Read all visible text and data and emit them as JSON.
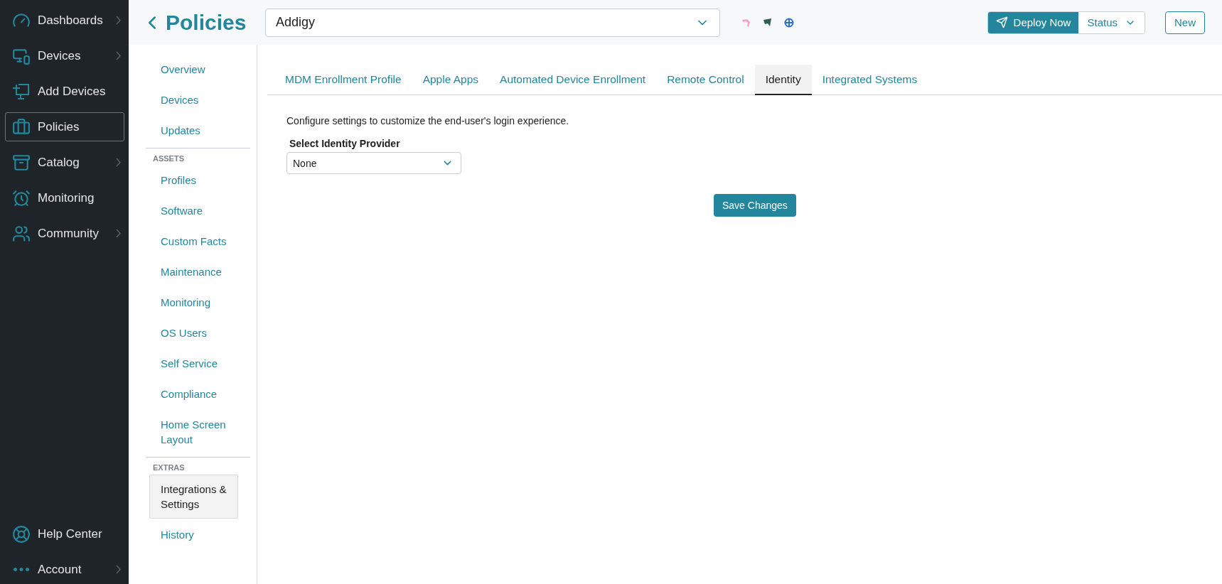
{
  "sidebar": {
    "items": [
      {
        "label": "Dashboards",
        "selected": false,
        "expandable": true
      },
      {
        "label": "Devices",
        "selected": false,
        "expandable": true
      },
      {
        "label": "Add Devices",
        "selected": false,
        "expandable": false
      },
      {
        "label": "Policies",
        "selected": true,
        "expandable": false
      },
      {
        "label": "Catalog",
        "selected": false,
        "expandable": true
      },
      {
        "label": "Monitoring",
        "selected": false,
        "expandable": false
      },
      {
        "label": "Community",
        "selected": false,
        "expandable": true
      }
    ],
    "footer_items": [
      {
        "label": "Help Center",
        "selected": false,
        "expandable": false
      },
      {
        "label": "Account",
        "selected": false,
        "expandable": true
      }
    ]
  },
  "header": {
    "title": "Policies",
    "policy_select": {
      "value": "Addigy"
    },
    "buttons": {
      "deploy": "Deploy Now",
      "status": "Status",
      "new": "New"
    }
  },
  "subnav": {
    "groups": [
      {
        "items": [
          {
            "label": "Overview",
            "selected": false
          },
          {
            "label": "Devices",
            "selected": false
          },
          {
            "label": "Updates",
            "selected": false
          }
        ]
      },
      {
        "heading": "ASSETS",
        "items": [
          {
            "label": "Profiles",
            "selected": false
          },
          {
            "label": "Software",
            "selected": false
          },
          {
            "label": "Custom Facts",
            "selected": false
          },
          {
            "label": "Maintenance",
            "selected": false
          },
          {
            "label": "Monitoring",
            "selected": false
          },
          {
            "label": "OS Users",
            "selected": false
          },
          {
            "label": "Self Service",
            "selected": false
          },
          {
            "label": "Compliance",
            "selected": false
          },
          {
            "label": "Home Screen Layout",
            "selected": false
          }
        ]
      },
      {
        "heading": "EXTRAS",
        "items": [
          {
            "label": "Integrations & Settings",
            "selected": true
          },
          {
            "label": "History",
            "selected": false
          }
        ]
      }
    ]
  },
  "tabs": [
    {
      "label": "MDM Enrollment Profile",
      "selected": false
    },
    {
      "label": "Apple Apps",
      "selected": false
    },
    {
      "label": "Automated Device Enrollment",
      "selected": false
    },
    {
      "label": "Remote Control",
      "selected": false
    },
    {
      "label": "Identity",
      "selected": true
    },
    {
      "label": "Integrated Systems",
      "selected": false
    }
  ],
  "identity": {
    "description": "Configure settings to customize the end-user's login experience.",
    "provider_label": "Select Identity Provider",
    "provider_value": "None",
    "save_button": "Save Changes"
  }
}
